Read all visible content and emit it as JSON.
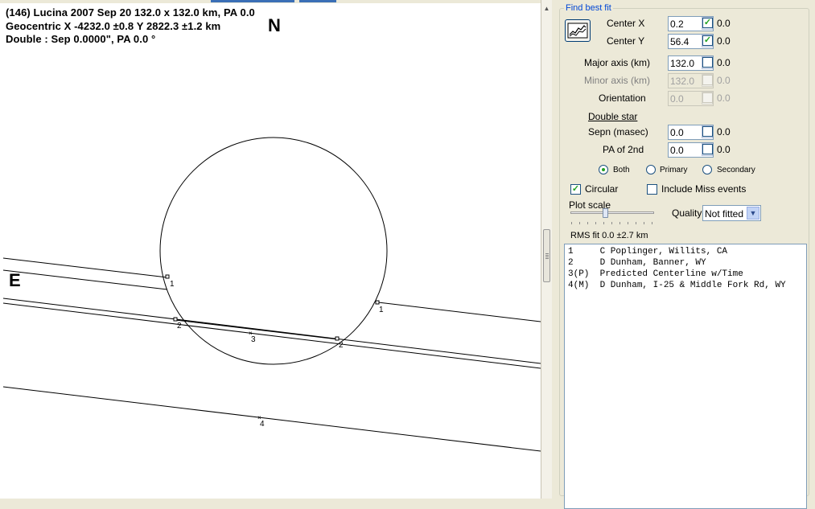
{
  "plot": {
    "line1": "(146) Lucina  2007 Sep 20  132.0 x 132.0 km, PA 0.0",
    "line2": "Geocentric  X  -4232.0 ±0.8   Y 2822.3 ±1.2 km",
    "line3": "Double : Sep  0.0000\", PA 0.0 °",
    "north": "N",
    "east": "E",
    "chord_labels": {
      "c1a": "1",
      "c1b": "1",
      "c2a": "2",
      "c2b": "2",
      "c3": "3",
      "c4": "4"
    }
  },
  "panel": {
    "title": "Find best fit",
    "center_x": {
      "label": "Center X",
      "value": "0.2",
      "check": "0.0",
      "checked": true
    },
    "center_y": {
      "label": "Center Y",
      "value": "56.4",
      "check": "0.0",
      "checked": true
    },
    "major": {
      "label": "Major axis (km)",
      "value": "132.0",
      "check": "0.0",
      "checked": false
    },
    "minor": {
      "label": "Minor axis (km)",
      "value": "132.0",
      "check": "0.0",
      "checked": false,
      "disabled": true
    },
    "orientation": {
      "label": "Orientation",
      "value": "0.0",
      "check": "0.0",
      "checked": false,
      "disabled": true
    },
    "double_star": "Double star",
    "sepn": {
      "label": "Sepn (masec)",
      "value": "0.0",
      "check": "0.0",
      "checked": false
    },
    "pa2": {
      "label": "PA of 2nd",
      "value": "0.0",
      "check": "0.0",
      "checked": false
    },
    "radio_both": "Both",
    "radio_primary": "Primary",
    "radio_secondary": "Secondary",
    "circular": "Circular",
    "include_miss": "Include Miss events",
    "plot_scale": "Plot scale",
    "quality_label": "Quality",
    "quality_value": "Not fitted",
    "rms": "RMS fit 0.0 ±2.7 km",
    "events": [
      "1     C Poplinger, Willits, CA",
      "2     D Dunham, Banner, WY",
      "3(P)  Predicted Centerline w/Time",
      "4(M)  D Dunham, I-25 & Middle Fork Rd, WY"
    ]
  },
  "colors": {
    "accent": "#0046d5",
    "check": "#21a121"
  }
}
